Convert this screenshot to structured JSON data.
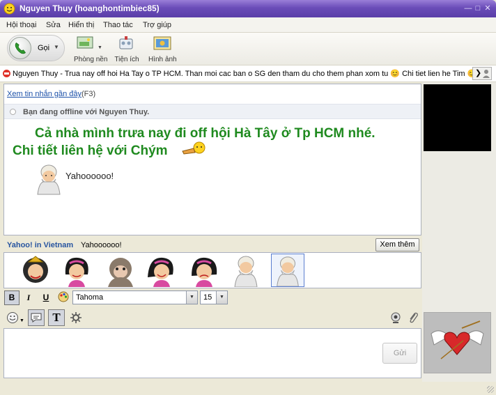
{
  "window": {
    "title": "Nguyen Thuy (hoanghontimbiec85)"
  },
  "menu": [
    "Hội thoại",
    "Sửa",
    "Hiển thị",
    "Thao tác",
    "Trợ giúp"
  ],
  "toolbar": {
    "call_label": "Gọi",
    "buttons": [
      {
        "label": "Phòng nền",
        "icon": "background-room-icon"
      },
      {
        "label": "Tiện ích",
        "icon": "plugins-icon"
      },
      {
        "label": "Hình ảnh",
        "icon": "photos-icon"
      }
    ]
  },
  "status_message": "Nguyen Thuy - Trua nay off hoi Ha Tay o TP HCM. Than moi cac ban o SG den tham du cho them phan xom tu 😊 Chi tiet lien he Tim 😊",
  "conversation": {
    "recent_link": "Xem tin nhắn gần đây",
    "recent_shortcut": "(F3)",
    "offline_notice": "Bạn đang offline với Nguyen Thuy.",
    "message_line1": "Cả nhà mình trưa nay đi off hội Hà Tây ở Tp HCM nhé.",
    "message_line2": "Chi tiết liên hệ với Chým",
    "audible_text": "Yahoooooo!"
  },
  "audibles": {
    "source": "Yahoo! in Vietnam",
    "text": "Yahoooooo!",
    "see_more": "Xem thêm",
    "items": [
      "queen-avatar",
      "girl-avatar",
      "monkey-avatar",
      "girl-smile-avatar",
      "girl-sad-avatar",
      "sage-avatar",
      "sage-avatar-selected"
    ]
  },
  "format": {
    "bold": "B",
    "italic": "I",
    "underline": "U",
    "font": "Tahoma",
    "size": "15"
  },
  "input": {
    "send_label": "Gửi",
    "value": ""
  },
  "colors": {
    "title_bar": "#6a4cb8",
    "message_green": "#1f8a1f",
    "link_blue": "#1a4fa8"
  }
}
